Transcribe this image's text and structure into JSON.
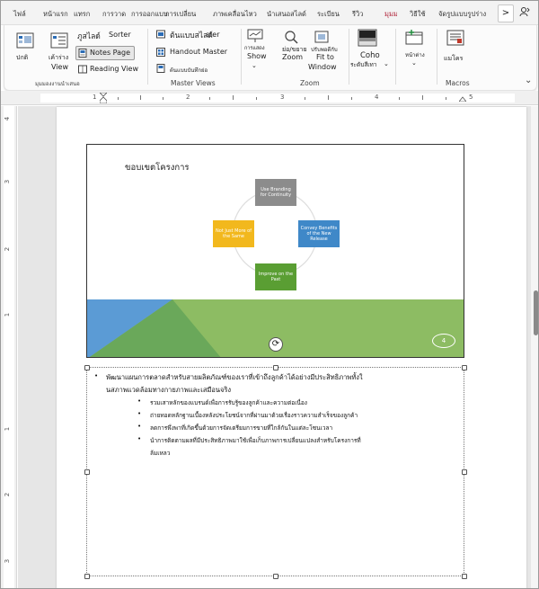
{
  "tabs": [
    "ไฟล์",
    "หน้าแรก",
    "แทรก",
    "การวาด",
    "การออกแบบ",
    "การเปลี่ยน",
    "ภาพเคลื่อนไหว",
    "นำเสนอสไลด์",
    "ระเบียน",
    "รีวิว",
    "มุมมอง",
    "วิธีใช้",
    "จัดรูปแบบรูปร่าง"
  ],
  "tab_nav": ">",
  "ribbon": {
    "normal": "ปกติ",
    "outline_view": "เค้าร่าง",
    "outline_view2": "View",
    "slide_sorter_a": "ภูสไลด์",
    "slide_sorter_b": "Sorter",
    "notes_page": "Notes Page",
    "reading_view": "Reading View",
    "group_presentation_views": "มุมมองงานนำเสนอ",
    "slide_master": "ต้นแบบสไลด์",
    "slide_master_b": "ster",
    "handout_master": "Handout Master",
    "notes_master": "ต้นแบบบันทึกย่อ",
    "group_master_views": "Master Views",
    "show": "การแสดง",
    "show_b": "Show",
    "zoom": "ย่อ/ขยาย",
    "zoom_b": "Zoom",
    "fit_window": "ปรับพอดีกับ",
    "fit_window_b": "Fit to",
    "fit_window_c": "Window",
    "group_zoom": "Zoom",
    "color": "Coho",
    "color_b": "ระดับสีเทา",
    "window": "หน้าต่าง",
    "macros": "แมโคร",
    "group_macros": "Macros"
  },
  "ruler_h": [
    "1",
    "2",
    "3",
    "4",
    "5"
  ],
  "ruler_v": [
    "4",
    "3",
    "2",
    "1",
    "1",
    "2",
    "3"
  ],
  "slide": {
    "title": "ขอบเขตโครงการ",
    "box_top": "Use Branding for Continuity",
    "box_right": "Convey Benefits of the New Release",
    "box_bottom": "Improve on the Past",
    "box_left": "Not Just More of the Same",
    "page_number": "4"
  },
  "notes": {
    "line1": "พัฒนาแผนการตลาดสำหรับสายผลิตภัณฑ์ของเราที่เข้าถึงลูกค้าได้อย่างมีประสิทธิภาพทั้งใ",
    "line2": "นสภาพแวดล้อมทางกายภาพและเสมือนจริง",
    "sub1": "รวมเสาหลักของแบรนด์เพื่อการรับรู้ของลูกค้าและความต่อเนื่อง",
    "sub2": "ถ่ายทอดหลักฐานเบื้องหลังประโยชน์จากที่ผ่านมาด้วยเรื่องราวความสำเร็จของลูกค้า",
    "sub3": "ลดการพึ่งพาที่เกิดขึ้นด้วยการจัดเตรียมการขายที่ใกล้กันในแต่ละโซนเวลา",
    "sub4a": "นำการติดตามผลที่มีประสิทธิภาพมาใช้เพื่อเก็บภาพการเปลี่ยนแปลงสำหรับโครงการที่",
    "sub4b": "ล้มเหลว"
  },
  "colors": {
    "accent": "#b0243a",
    "box_gray": "#8c8c8c",
    "box_blue": "#3f88c8",
    "box_yellow": "#f2b81d",
    "box_green": "#5a9e33",
    "green_band": "#8dbc63",
    "blue_tri": "#5b9bd5"
  }
}
